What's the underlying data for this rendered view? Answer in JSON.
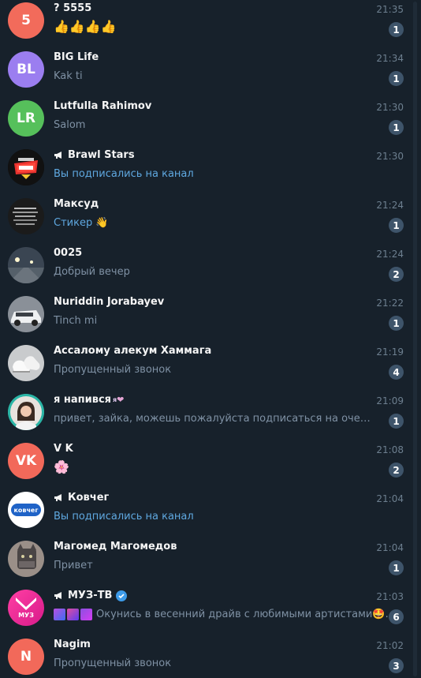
{
  "colors": {
    "background": "#17212b",
    "accent_text": "#5fa8e0",
    "muted_text": "#7f91a4",
    "badge": "#3e546a"
  },
  "chats": [
    {
      "avatar": {
        "type": "initials",
        "text": "5",
        "color": "#f26b5b"
      },
      "name": "? 5555",
      "time": "21:35",
      "message": "👍👍👍👍",
      "message_style": "emoji",
      "unread": "1"
    },
    {
      "avatar": {
        "type": "initials",
        "text": "BL",
        "color": "#9b7ef0"
      },
      "name": "BIG Life",
      "time": "21:34",
      "message": "Kak ti",
      "unread": "1"
    },
    {
      "avatar": {
        "type": "initials",
        "text": "LR",
        "color": "#56c05b"
      },
      "name": "Lutfulla Rahimov",
      "time": "21:30",
      "message": "Salom",
      "unread": "1"
    },
    {
      "avatar": {
        "type": "image",
        "icon": "brawl-stars-logo"
      },
      "name": "Brawl Stars",
      "channel": true,
      "time": "21:30",
      "message": "Вы подписались на канал",
      "message_style": "accent"
    },
    {
      "avatar": {
        "type": "image",
        "icon": "text-photo"
      },
      "name": "Максуд",
      "time": "21:24",
      "message": "Стикер 👋",
      "message_style": "accent",
      "unread": "1"
    },
    {
      "avatar": {
        "type": "image",
        "icon": "night-road-photo"
      },
      "name": "0025",
      "time": "21:24",
      "message": "Добрый вечер",
      "unread": "2"
    },
    {
      "avatar": {
        "type": "image",
        "icon": "white-car-photo"
      },
      "name": "Nuriddin Jorabayev",
      "time": "21:22",
      "message": "Tinch mi",
      "unread": "1"
    },
    {
      "avatar": {
        "type": "image",
        "icon": "white-sneakers-photo"
      },
      "name": "Ассалому алекум Хаммага",
      "time": "21:19",
      "message": "Пропущенный звонок",
      "unread": "4"
    },
    {
      "avatar": {
        "type": "image",
        "icon": "girl-portrait-photo"
      },
      "name": "я напився",
      "name_extra": "❤",
      "name_tag": "я",
      "time": "21:09",
      "message": "привет, зайка, можешь пожалуйста подписаться на очень комфо...",
      "unread": "1"
    },
    {
      "avatar": {
        "type": "initials",
        "text": "VK",
        "color": "#f2695a"
      },
      "name": "V K",
      "time": "21:08",
      "message": "🌸",
      "message_style": "emoji",
      "unread": "2"
    },
    {
      "avatar": {
        "type": "image",
        "icon": "kovcheg-logo",
        "text": "ковчег"
      },
      "name": "Ковчег",
      "channel": true,
      "time": "21:04",
      "message": "Вы подписались на канал",
      "message_style": "accent"
    },
    {
      "avatar": {
        "type": "image",
        "icon": "cat-photo"
      },
      "name": "Магомед Магомедов",
      "time": "21:04",
      "message": "Привет",
      "unread": "1"
    },
    {
      "avatar": {
        "type": "image",
        "icon": "muz-tv-logo",
        "text": "МУЗ"
      },
      "name": "МУЗ-ТВ",
      "channel": true,
      "verified": true,
      "time": "21:03",
      "message": "Окунись в весенний драйв с любимыми артистами🤩...",
      "unread": "6"
    },
    {
      "avatar": {
        "type": "initials",
        "text": "N",
        "color": "#f2695a"
      },
      "name": "Nagim",
      "time": "21:02",
      "message": "Пропущенный звонок",
      "unread": "3"
    }
  ]
}
